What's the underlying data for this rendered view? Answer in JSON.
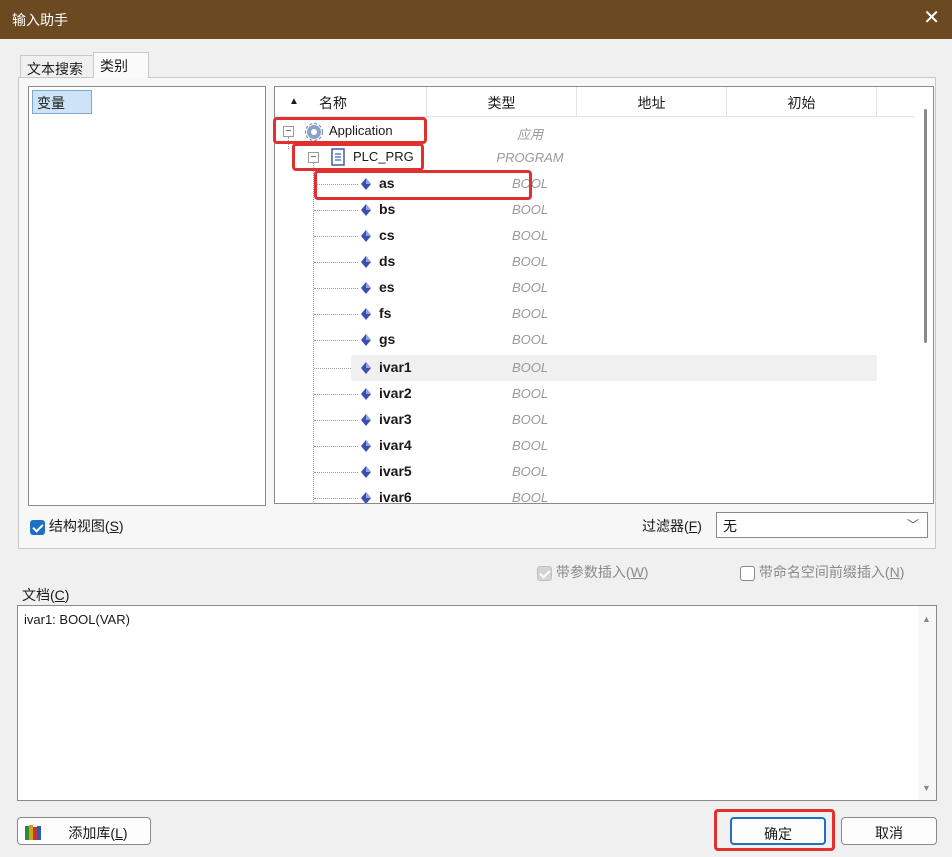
{
  "window": {
    "title": "输入助手",
    "close_glyph": "✕"
  },
  "tabs": [
    {
      "label": "文本搜索"
    },
    {
      "label": "类别"
    }
  ],
  "categories": [
    {
      "label": "变量"
    }
  ],
  "tree": {
    "columns": [
      "名称",
      "类型",
      "地址",
      "初始"
    ],
    "application": {
      "name": "Application",
      "type": "应用"
    },
    "program": {
      "name": "PLC_PRG",
      "type": "PROGRAM"
    },
    "variables": [
      {
        "name": "as",
        "type": "BOOL"
      },
      {
        "name": "bs",
        "type": "BOOL"
      },
      {
        "name": "cs",
        "type": "BOOL"
      },
      {
        "name": "ds",
        "type": "BOOL"
      },
      {
        "name": "es",
        "type": "BOOL"
      },
      {
        "name": "fs",
        "type": "BOOL"
      },
      {
        "name": "gs",
        "type": "BOOL"
      },
      {
        "name": "ivar1",
        "type": "BOOL"
      },
      {
        "name": "ivar2",
        "type": "BOOL"
      },
      {
        "name": "ivar3",
        "type": "BOOL"
      },
      {
        "name": "ivar4",
        "type": "BOOL"
      },
      {
        "name": "ivar5",
        "type": "BOOL"
      },
      {
        "name": "ivar6",
        "type": "BOOL"
      }
    ],
    "selected_variable": "ivar1"
  },
  "options": {
    "structure_view": {
      "label": "结构视图",
      "accel": "S",
      "checked": true
    },
    "filter": {
      "label": "过滤器",
      "accel": "F",
      "value": "无"
    },
    "insert_with_args": {
      "label": "带参数插入",
      "accel": "W",
      "checked": true,
      "enabled": false
    },
    "insert_with_ns": {
      "label": "带命名空间前缀插入",
      "accel": "N",
      "checked": false,
      "enabled": false
    }
  },
  "documentation": {
    "label": "文档",
    "accel": "C",
    "text": "ivar1: BOOL(VAR)"
  },
  "buttons": {
    "add_library": {
      "label": "添加库",
      "accel": "L"
    },
    "ok": {
      "label": "确定"
    },
    "cancel": {
      "label": "取消"
    }
  },
  "colors": {
    "titlebar": "#6b4a22",
    "highlight": "#e03030",
    "accent": "#1f6fc4"
  }
}
